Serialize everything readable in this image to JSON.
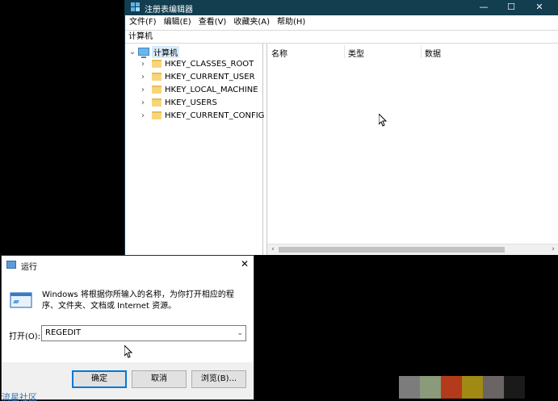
{
  "regedit": {
    "title": "注册表编辑器",
    "menu": [
      "文件(F)",
      "编辑(E)",
      "查看(V)",
      "收藏夹(A)",
      "帮助(H)"
    ],
    "address": "计算机",
    "tree": {
      "root": "计算机",
      "children": [
        "HKEY_CLASSES_ROOT",
        "HKEY_CURRENT_USER",
        "HKEY_LOCAL_MACHINE",
        "HKEY_USERS",
        "HKEY_CURRENT_CONFIG"
      ]
    },
    "columns": [
      "名称",
      "类型",
      "数据"
    ],
    "window_controls": {
      "minimize": "—",
      "maximize": "☐",
      "close": "✕"
    }
  },
  "run_dialog": {
    "title": "运行",
    "description": "Windows 将根据你所输入的名称，为你打开相应的程序、文件夹、文档或 Internet 资源。",
    "open_label": "打开(O):",
    "input_value": "REGEDIT",
    "buttons": {
      "ok": "确定",
      "cancel": "取消",
      "browse": "浏览(B)..."
    },
    "close": "✕"
  },
  "watermark": "流星社区",
  "colors": {
    "titlebar": "#123e4f",
    "accent": "#0078d7",
    "swatches": [
      "#7c7c7c",
      "#8a9a7a",
      "#b33a1a",
      "#a08a14",
      "#6a6464",
      "#1a1a1a"
    ]
  }
}
